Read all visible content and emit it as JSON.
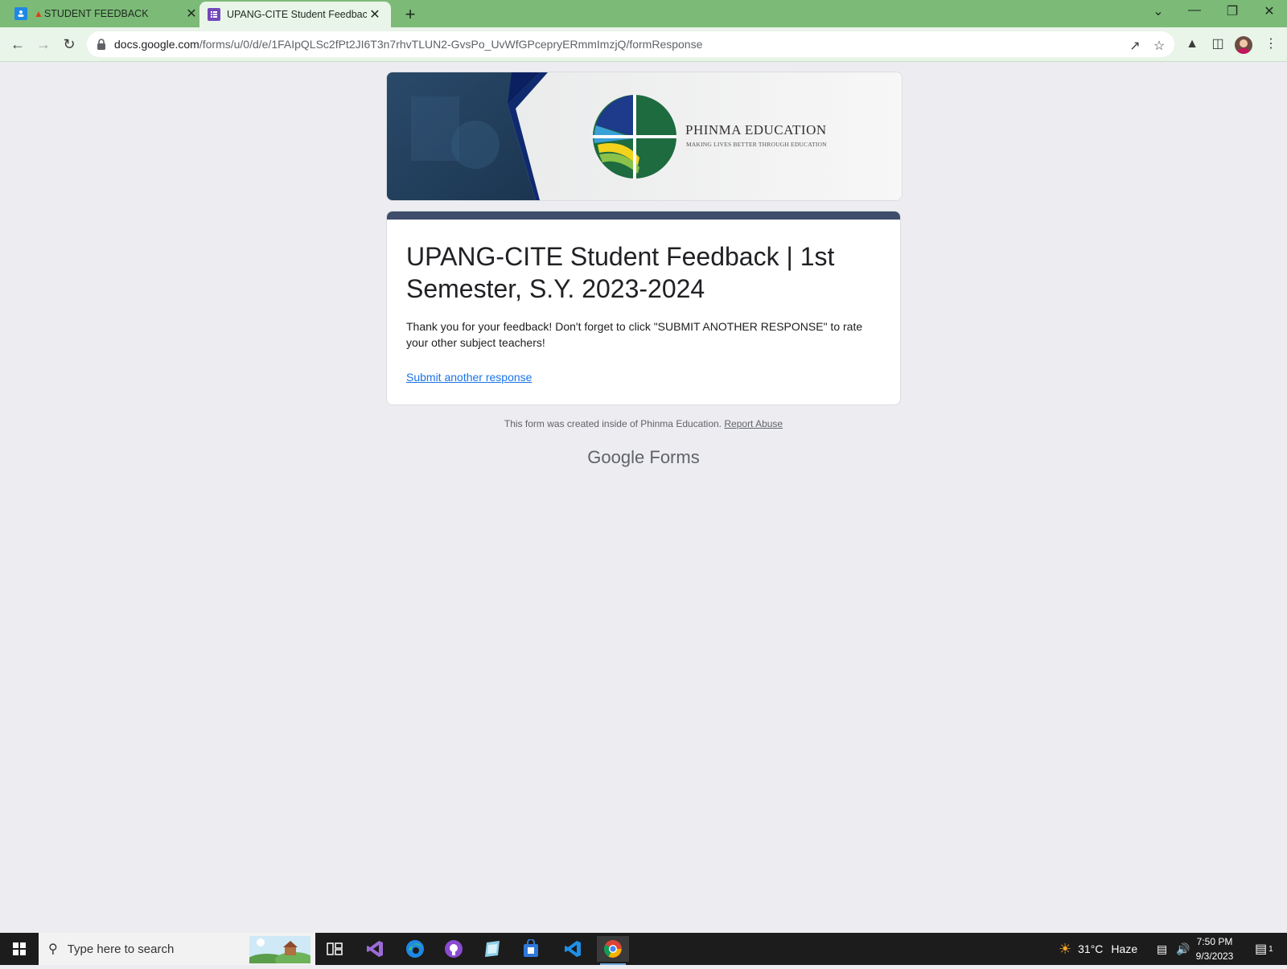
{
  "browser": {
    "tabs": [
      {
        "title": "STUDENT FEEDBACK",
        "icon": "google-classroom-icon",
        "active": false
      },
      {
        "title": "UPANG-CITE Student Feedback |",
        "icon": "google-forms-icon",
        "active": true
      }
    ],
    "url": {
      "host": "docs.google.com",
      "path": "/forms/u/0/d/e/1FAIpQLSc2fPt2JI6T3n7rhvTLUN2-GvsPo_UvWfGPcepryERmmImzjQ/formResponse"
    }
  },
  "form": {
    "banner": {
      "brand": "PHINMA EDUCATION",
      "tagline": "MAKING LIVES BETTER THROUGH EDUCATION"
    },
    "title": "UPANG-CITE Student Feedback | 1st Semester, S.Y. 2023-2024",
    "message": "Thank you for your feedback! Don't forget to click \"SUBMIT ANOTHER RESPONSE\" to rate your other subject teachers!",
    "link": "Submit another response",
    "footer_note": "This form was created inside of Phinma Education.",
    "report_abuse": "Report Abuse",
    "brand_google": "Google",
    "brand_forms": "Forms"
  },
  "taskbar": {
    "search_placeholder": "Type here to search",
    "weather": "31°C",
    "weather_desc": "Haze",
    "time": "7:50 PM",
    "date": "9/3/2023",
    "notification_count": "1",
    "accent": "#6fa8dc"
  },
  "colors": {
    "tabstrip": "#7cba78",
    "form_band": "#3e4d6b",
    "link": "#1a73e8"
  }
}
